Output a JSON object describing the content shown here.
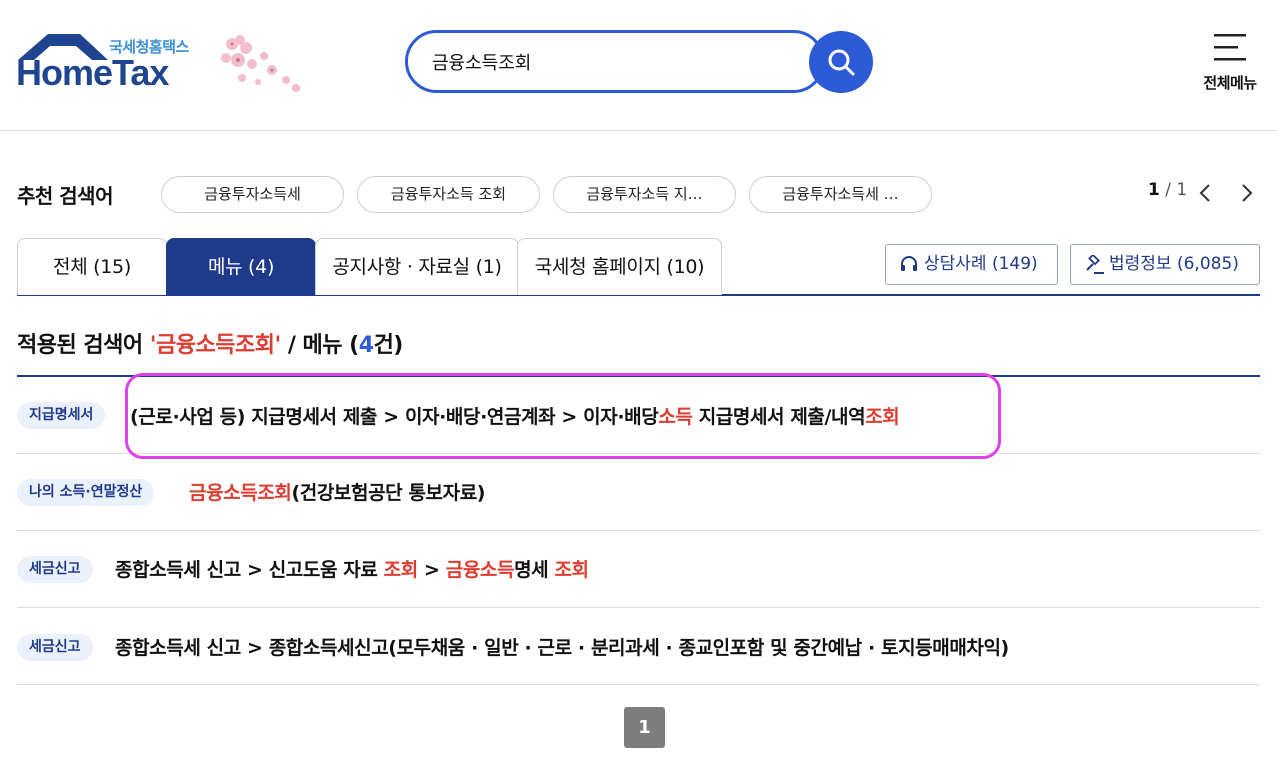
{
  "logo": {
    "sub": "국세청홈택스",
    "main": "HomeTax"
  },
  "search": {
    "value": "금융소득조회"
  },
  "all_menu": {
    "label": "전체메뉴"
  },
  "recommend": {
    "title": "추천 검색어",
    "chips": [
      "금융투자소득세",
      "금융투자소득 조회",
      "금융투자소득 지…",
      "금융투자소득세 …"
    ],
    "page_current": "1",
    "page_sep": " / ",
    "page_total": "1"
  },
  "tabs": [
    {
      "label": "전체 (15)"
    },
    {
      "label": "메뉴 (4)"
    },
    {
      "label": "공지사항 · 자료실 (1)"
    },
    {
      "label": "국세청 홈페이지 (10)"
    }
  ],
  "side_buttons": {
    "consult": "상담사례 (149)",
    "law": "법령정보 (6,085)"
  },
  "result_heading": {
    "prefix": "적용된 검색어 ",
    "keyword": "'금융소득조회'",
    "middle": " / 메뉴 (",
    "count": "4",
    "suffix": "건)"
  },
  "rows": [
    {
      "badge": "지급명세서",
      "parts": [
        "(근로·사업 등) 지급명세서 제출 > 이자·배당·연금계좌 > 이자·배당",
        "소득",
        " 지급명세서 제출/내역",
        "조회"
      ]
    },
    {
      "badge": "나의 소득·연말정산",
      "parts": [
        "금융소득조회",
        "(건강보험공단 통보자료)"
      ]
    },
    {
      "badge": "세금신고",
      "parts": [
        "종합소득세 신고 > 신고도움 자료 ",
        "조회",
        " > ",
        "금융소득",
        "명세 ",
        "조회"
      ]
    },
    {
      "badge": "세금신고",
      "parts": [
        "종합소득세 신고 > 종합소득세신고(모두채움 · 일반 · 근로 · 분리과세 · 종교인포함 및 중간예납 · 토지등매매차익)"
      ]
    }
  ],
  "pagination": {
    "current": "1"
  },
  "colors": {
    "primary": "#1f3a8a",
    "accent": "#2d5bd7",
    "highlight": "#e03b2f",
    "selection": "#e040e8"
  }
}
